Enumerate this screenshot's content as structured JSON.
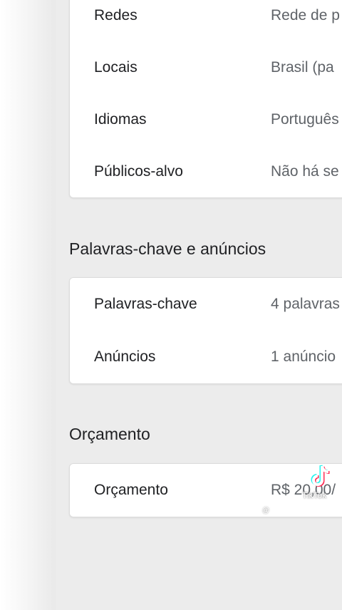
{
  "settings_rows": [
    {
      "label": "Redes",
      "value": "Rede de p"
    },
    {
      "label": "Locais",
      "value": "Brasil (pa"
    },
    {
      "label": "Idiomas",
      "value": "Português"
    },
    {
      "label": "Públicos-alvo",
      "value": "Não há se"
    }
  ],
  "keywords_section": {
    "title": "Palavras-chave e anúncios",
    "rows": [
      {
        "label": "Palavras-chave",
        "value": "4 palavras"
      },
      {
        "label": "Anúncios",
        "value": "1 anúncio"
      }
    ]
  },
  "budget_section": {
    "title": "Orçamento",
    "rows": [
      {
        "label": "Orçamento",
        "value": "R$ 20,00/"
      }
    ]
  },
  "watermark": {
    "brand": "TikTok",
    "handle": "@"
  }
}
